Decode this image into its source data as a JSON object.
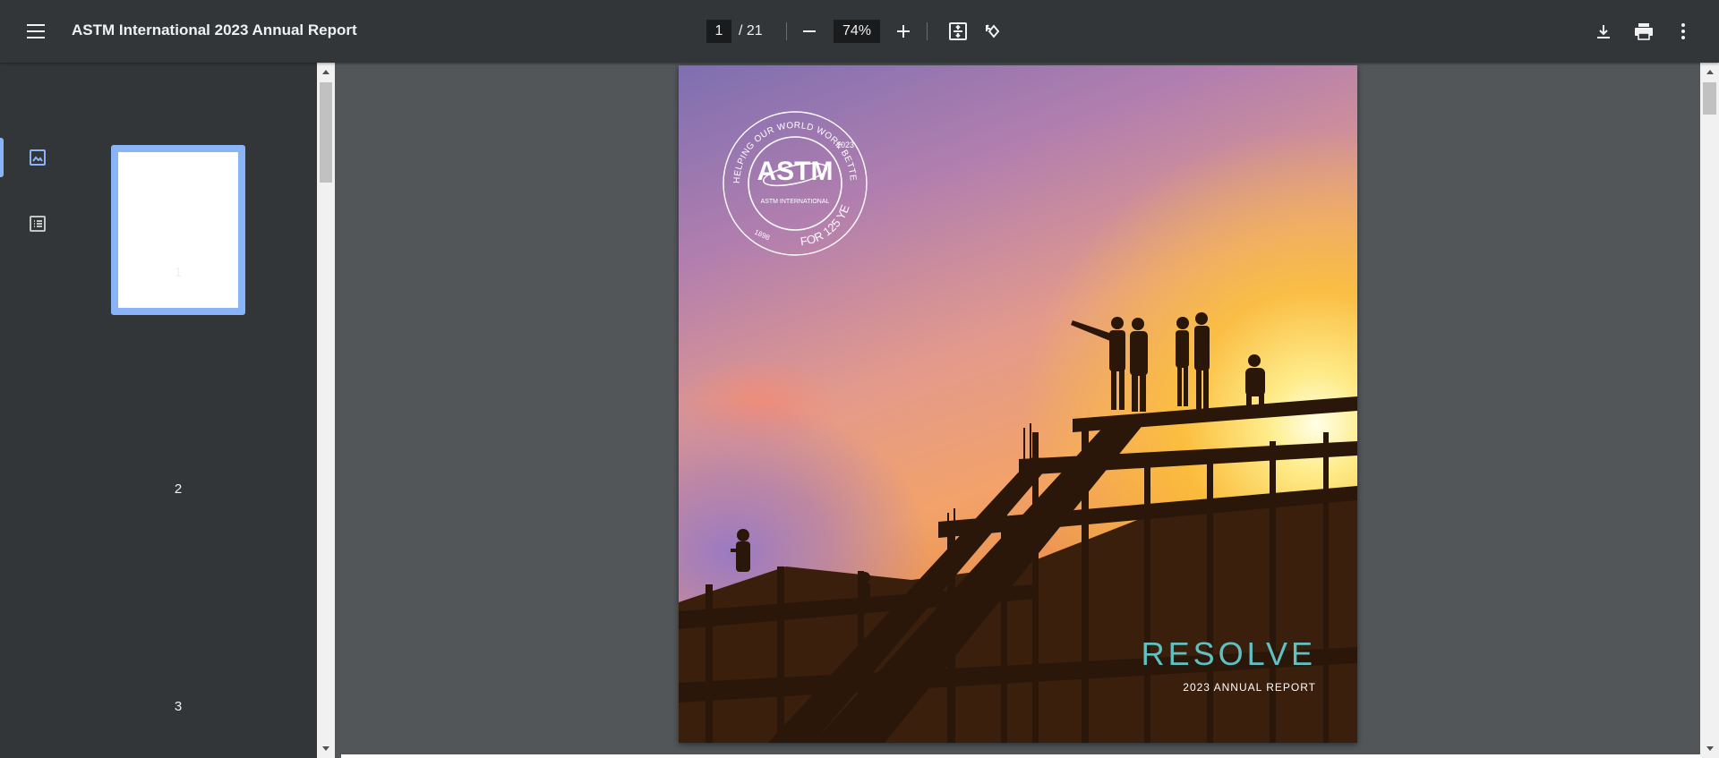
{
  "toolbar": {
    "menu_icon": "hamburger-menu-icon",
    "title": "ASTM International 2023 Annual Report",
    "page_current": "1",
    "page_total": "/ 21",
    "zoom": "74%",
    "icons": [
      "minus-icon",
      "plus-icon",
      "fit-page-icon",
      "rotate-icon",
      "download-icon",
      "print-icon",
      "more-vert-icon"
    ]
  },
  "sidebar": {
    "tabs": [
      {
        "icon": "thumbnail-view-icon",
        "active": true
      },
      {
        "icon": "outline-view-icon",
        "active": false
      }
    ],
    "thumbnails": [
      "1",
      "2",
      "3"
    ],
    "accent": "#8ab4f8"
  },
  "document": {
    "seal_top_text": "HELPING OUR WORLD WORK BETTER",
    "seal_year": "2023",
    "seal_center": "ASTM",
    "seal_org": "ASTM INTERNATIONAL",
    "seal_founded": "1898",
    "seal_bottom_text": "FOR 125 YEARS",
    "headline": "RESOLVE",
    "subheadline": "2023 ANNUAL REPORT",
    "headline_color": "#5fc1c1"
  }
}
